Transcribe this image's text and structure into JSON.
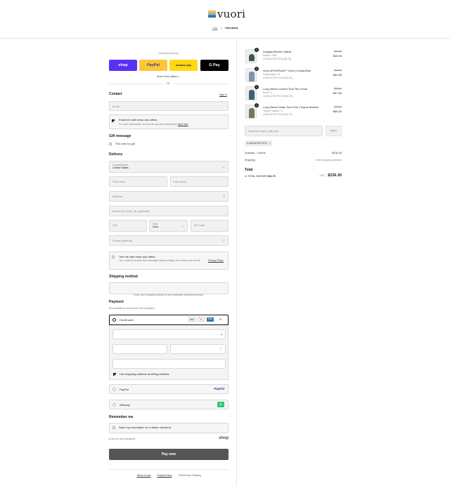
{
  "brand": {
    "name": "vuori"
  },
  "breadcrumb": {
    "cart": "Cart",
    "separator": ">",
    "current": "Checkout"
  },
  "express": {
    "title": "Express checkout",
    "shop": "shop",
    "paypal": "PayPal",
    "amazon": "amazon pay",
    "gpay": "G Pay",
    "more": "Show more options",
    "or": "OR"
  },
  "contact": {
    "title": "Contact",
    "sign_in": "Sign in",
    "email_placeholder": "Email",
    "newsletter_label": "Email me with news and offers.",
    "newsletter_sub": "For more information on how we use your information",
    "newsletter_link": "click here"
  },
  "gift": {
    "title": "Gift message",
    "label": "This order is a gift"
  },
  "delivery": {
    "title": "Delivery",
    "country_label": "Country/Region",
    "country_value": "United States",
    "first_name": "First name",
    "last_name": "Last name",
    "address": "Address",
    "apartment": "Apartment, suite, etc. (optional)",
    "city": "City",
    "state_label": "State",
    "state_value": "Iowa",
    "zip": "ZIP code",
    "phone": "Phone (optional)",
    "sms_label": "Text me with news and offers",
    "sms_sub": "Yes, I want to receive text messages about exciting Vuori news and events.",
    "sms_link": "Privacy Policy"
  },
  "shipping": {
    "title": "Shipping method",
    "notice": "Enter your shipping address to view available shipping methods."
  },
  "payment": {
    "title": "Payment",
    "subtitle": "All transactions are secure and encrypted.",
    "credit_card": "Credit card",
    "card_badges": [
      "VISA",
      "MC",
      "AMEX"
    ],
    "more_cards": "+5",
    "billing_label": "Use shipping address as billing address",
    "paypal": "PayPal",
    "paypal_logo": "PayPal",
    "afterpay": "Afterpay",
    "afterpay_logo": "$"
  },
  "remember": {
    "title": "Remember me",
    "label": "Save my information for a faster checkout",
    "secure": "Secure and encrypted",
    "shop": "shop"
  },
  "pay_now": "Pay now",
  "footer": {
    "terms": "Terms of Use",
    "privacy": "Privacy Policy",
    "copyright": "©2025 Vuori Clothing"
  },
  "order": {
    "items": [
      {
        "qty": "1",
        "name": "Douglas Beanie | Marsh",
        "variant": "Marsh / ONS",
        "discount": "MIL24TZ07YCG ($6.75)",
        "old_price": "$54.00",
        "price": "$45.35",
        "color": "#3f5a48"
      },
      {
        "qty": "1",
        "name": "Vuori AirThePixels™ Cami | Crystal Blue",
        "variant": "Crystal Blue / M",
        "discount": "MIL24TZ07YCG ($11.15)",
        "old_price": "$74.00",
        "price": "$62.85",
        "color": "#7b96b0"
      },
      {
        "qty": "1",
        "name": "Long Sleeve Current Tech Tee | Pond",
        "variant": "Pond / S",
        "discount": "MIL24TZ07YCG ($10.20)",
        "old_price": "$68.00",
        "price": "$57.80",
        "color": "#3e5f74"
      },
      {
        "qty": "1",
        "name": "Long Sleeve Strato Tech Polo | Thyme Heather",
        "variant": "Thyme Heather / S",
        "discount": "MIL24TZ07YCG ($11.70)",
        "old_price": "$78.00",
        "price": "$66.30",
        "color": "#6e7a62"
      }
    ],
    "discount_placeholder": "Discount code or gift card",
    "apply": "Apply",
    "code_chip": "MIL24TZ07YCG",
    "subtotal_label": "Subtotal · 4 items",
    "subtotal_value": "$236.30",
    "shipping_label": "Shipping",
    "shipping_value": "Enter shipping address",
    "total_label": "Total",
    "currency": "USD",
    "total_value": "$236.30",
    "savings_label": "TOTAL SAVINGS",
    "savings_value": "$41.70"
  }
}
